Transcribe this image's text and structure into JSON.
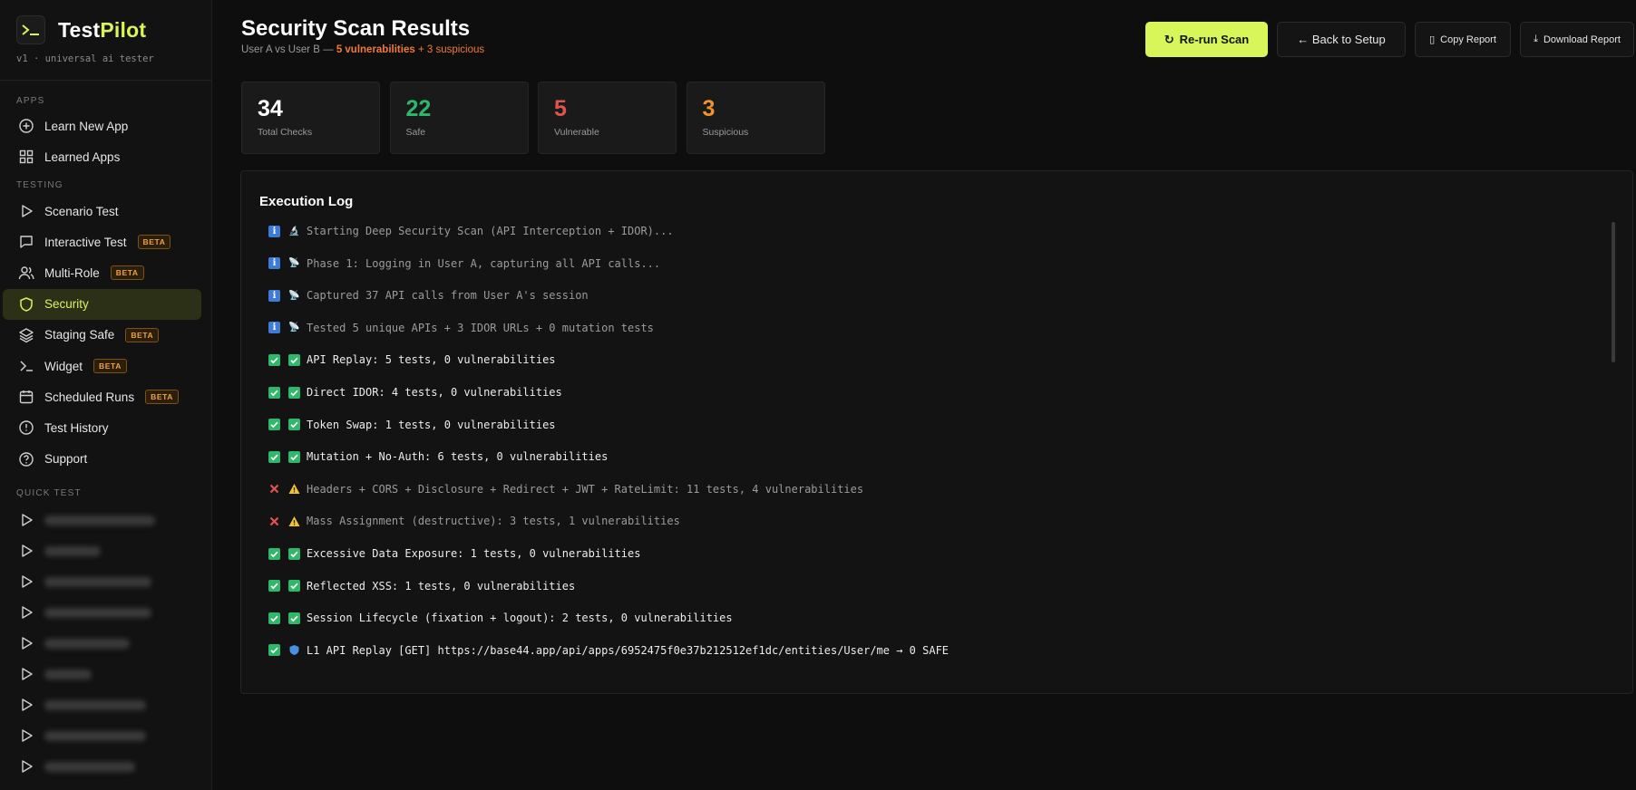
{
  "brand": {
    "name_a": "Test",
    "name_b": "Pilot",
    "tagline": "v1 · universal ai tester"
  },
  "sidebar": {
    "section_apps": "APPS",
    "section_testing": "TESTING",
    "section_quick": "QUICK TEST",
    "apps": [
      {
        "label": "Learn New App",
        "icon": "plus-circle-icon"
      },
      {
        "label": "Learned Apps",
        "icon": "grid-icon"
      }
    ],
    "testing": [
      {
        "label": "Scenario Test",
        "icon": "play-icon",
        "beta": ""
      },
      {
        "label": "Interactive Test",
        "icon": "chat-icon",
        "beta": "BETA"
      },
      {
        "label": "Multi-Role",
        "icon": "users-icon",
        "beta": "BETA"
      },
      {
        "label": "Security",
        "icon": "shield-icon",
        "beta": "",
        "active": true
      },
      {
        "label": "Staging Safe",
        "icon": "layers-icon",
        "beta": "BETA"
      },
      {
        "label": "Widget",
        "icon": "terminal-icon",
        "beta": "BETA"
      },
      {
        "label": "Scheduled Runs",
        "icon": "calendar-icon",
        "beta": "BETA"
      },
      {
        "label": "Test History",
        "icon": "clock-icon",
        "beta": ""
      },
      {
        "label": "Support",
        "icon": "help-icon",
        "beta": ""
      }
    ],
    "quick_count": 9
  },
  "header": {
    "title": "Security Scan Results",
    "subtitle_prefix": "User A vs User B — ",
    "subtitle_vuln": "5 vulnerabilities",
    "subtitle_susp": " + 3 suspicious",
    "rerun_label": "Re-run Scan",
    "back_label": "← Back to Setup",
    "copy_label": "Copy Report",
    "download_label": "Download Report"
  },
  "stats": [
    {
      "value": "34",
      "label": "Total Checks",
      "color": "#ffffff"
    },
    {
      "value": "22",
      "label": "Safe",
      "color": "#2fb86a"
    },
    {
      "value": "5",
      "label": "Vulnerable",
      "color": "#e0534f"
    },
    {
      "value": "3",
      "label": "Suspicious",
      "color": "#f0932b"
    }
  ],
  "log": {
    "title": "Execution Log",
    "lines": [
      {
        "status": "info",
        "emoji": "🔬",
        "text": "Starting Deep Security Scan (API Interception + IDOR)...",
        "bright": false
      },
      {
        "status": "info",
        "emoji": "📡",
        "text": "Phase 1: Logging in User A, capturing all API calls...",
        "bright": false
      },
      {
        "status": "info",
        "emoji": "📡",
        "text": "Captured 37 API calls from User A's session",
        "bright": false
      },
      {
        "status": "info",
        "emoji": "📡",
        "text": "Tested 5 unique APIs + 3 IDOR URLs + 0 mutation tests",
        "bright": false
      },
      {
        "status": "ok",
        "emoji": "check",
        "text": "API Replay: 5 tests, 0 vulnerabilities",
        "bright": true
      },
      {
        "status": "ok",
        "emoji": "check",
        "text": "Direct IDOR: 4 tests, 0 vulnerabilities",
        "bright": true
      },
      {
        "status": "ok",
        "emoji": "check",
        "text": "Token Swap: 1 tests, 0 vulnerabilities",
        "bright": true
      },
      {
        "status": "ok",
        "emoji": "check",
        "text": "Mutation + No-Auth: 6 tests, 0 vulnerabilities",
        "bright": true
      },
      {
        "status": "err",
        "emoji": "warn",
        "text": "Headers + CORS + Disclosure + Redirect + JWT + RateLimit: 11 tests, 4 vulnerabilities",
        "bright": false
      },
      {
        "status": "err",
        "emoji": "warn",
        "text": "Mass Assignment (destructive): 3 tests, 1 vulnerabilities",
        "bright": false
      },
      {
        "status": "ok",
        "emoji": "check",
        "text": "Excessive Data Exposure: 1 tests, 0 vulnerabilities",
        "bright": true
      },
      {
        "status": "ok",
        "emoji": "check",
        "text": "Reflected XSS: 1 tests, 0 vulnerabilities",
        "bright": true
      },
      {
        "status": "ok",
        "emoji": "check",
        "text": "Session Lifecycle (fixation + logout): 2 tests, 0 vulnerabilities",
        "bright": true
      },
      {
        "status": "ok",
        "emoji": "shield",
        "text": "L1 API Replay [GET] https://base44.app/api/apps/6952475f0e37b212512ef1dc/entities/User/me → 0 SAFE",
        "bright": true
      }
    ]
  },
  "colors": {
    "accent": "#d8f55a",
    "safe": "#2fb86a",
    "vuln": "#e0534f",
    "susp": "#f0932b",
    "info": "#3d7bd6"
  }
}
